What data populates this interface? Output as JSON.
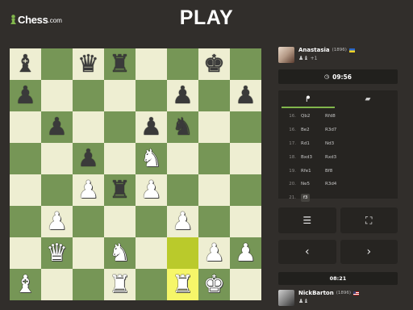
{
  "brand": {
    "name": "Chess",
    "domain": ".com"
  },
  "title": "PLAY",
  "board": {
    "highlight": [
      [
        6,
        5
      ],
      [
        7,
        5
      ]
    ],
    "squares": [
      [
        "b-bishop",
        "",
        "b-queen",
        "b-rook",
        "",
        "",
        "b-king",
        ""
      ],
      [
        "b-pawn",
        "",
        "",
        "",
        "",
        "b-pawn",
        "",
        "b-pawn"
      ],
      [
        "",
        "b-pawn",
        "",
        "",
        "b-pawn",
        "b-knight",
        "",
        ""
      ],
      [
        "",
        "",
        "b-pawn",
        "",
        "w-knight",
        "",
        "",
        ""
      ],
      [
        "",
        "",
        "w-pawn",
        "b-rook",
        "w-pawn",
        "",
        "",
        ""
      ],
      [
        "",
        "w-pawn",
        "",
        "",
        "",
        "w-pawn",
        "",
        ""
      ],
      [
        "",
        "w-queen",
        "",
        "w-knight",
        "",
        "",
        "w-pawn",
        "w-pawn"
      ],
      [
        "w-bishop",
        "",
        "",
        "w-rook",
        "",
        "w-rook",
        "w-king",
        ""
      ]
    ],
    "glyphs": {
      "w-king": "♚",
      "w-queen": "♛",
      "w-rook": "♜",
      "w-bishop": "♝",
      "w-knight": "♞",
      "w-pawn": "♟",
      "b-king": "♚",
      "b-queen": "♛",
      "b-rook": "♜",
      "b-bishop": "♝",
      "b-knight": "♞",
      "b-pawn": "♟"
    }
  },
  "top_player": {
    "name": "Anastasia",
    "rating": "(1896)",
    "flag": "ua",
    "captured": "♟♝",
    "advantage": "+1"
  },
  "top_clock": {
    "icon": "clock-icon",
    "time": "09:56"
  },
  "tabs": [
    {
      "icon": "moves-icon",
      "glyph": "⸮"
    },
    {
      "icon": "chat-icon",
      "glyph": "💬"
    }
  ],
  "moves": [
    {
      "num": "16.",
      "white": "Qb2",
      "black": "Rfd8"
    },
    {
      "num": "16.",
      "white": "Be2",
      "black": "R3d7"
    },
    {
      "num": "17.",
      "white": "Rd1",
      "black": "Nd3"
    },
    {
      "num": "18.",
      "white": "Bxd3",
      "black": "Rxd3"
    },
    {
      "num": "19.",
      "white": "Rfe1",
      "black": "Bf8"
    },
    {
      "num": "20.",
      "white": "Ne5",
      "black": "R3d4"
    },
    {
      "num": "21.",
      "white": "f3",
      "black": ""
    }
  ],
  "controls": {
    "list_glyph": "☰",
    "analysis_glyph": "⛶",
    "prev_glyph": "‹",
    "next_glyph": "›"
  },
  "bottom_clock": {
    "time": "08:21"
  },
  "bottom_player": {
    "name": "NickBarton",
    "rating": "(1896)",
    "flag": "us",
    "captured": "♟♝"
  }
}
